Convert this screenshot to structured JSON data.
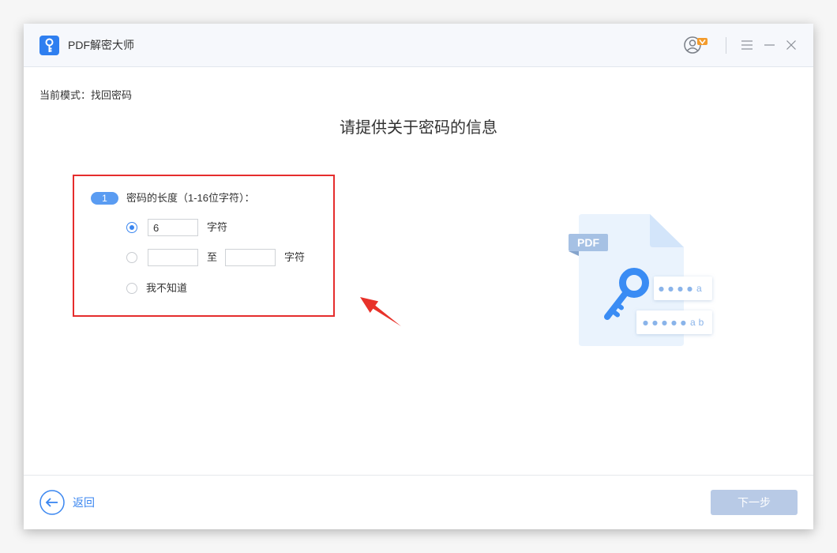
{
  "app": {
    "title": "PDF解密大师",
    "logo_icon": "key-icon"
  },
  "titlebar": {
    "account_icon": "user-icon",
    "badge_icon": "vip-badge-icon",
    "menu_icon": "menu-icon",
    "minimize_icon": "minimize-icon",
    "close_icon": "close-icon"
  },
  "mode": {
    "label": "当前模式：",
    "value": "找回密码"
  },
  "heading": "请提供关于密码的信息",
  "length_section": {
    "step": "1",
    "question": "密码的长度（1-16位字符）：",
    "options": [
      {
        "selected": true,
        "value": "6",
        "unit": "字符"
      },
      {
        "selected": false,
        "from": "",
        "separator": "至",
        "to": "",
        "unit": "字符"
      },
      {
        "selected": false,
        "label": "我不知道"
      }
    ]
  },
  "illustration": {
    "file_tag": "PDF",
    "password_hints": [
      {
        "mask": "●●●●",
        "chars": "a"
      },
      {
        "mask": "●●●●●",
        "chars": "ab"
      }
    ]
  },
  "footer": {
    "back_icon": "arrow-left-icon",
    "back_label": "返回",
    "next_label": "下一步",
    "next_enabled": false
  },
  "colors": {
    "accent": "#3a86f0",
    "highlight": "#e52d2d",
    "disabled_button": "#b8cae6",
    "step_badge": "#5a9cf2",
    "key": "#3a8cf4"
  }
}
